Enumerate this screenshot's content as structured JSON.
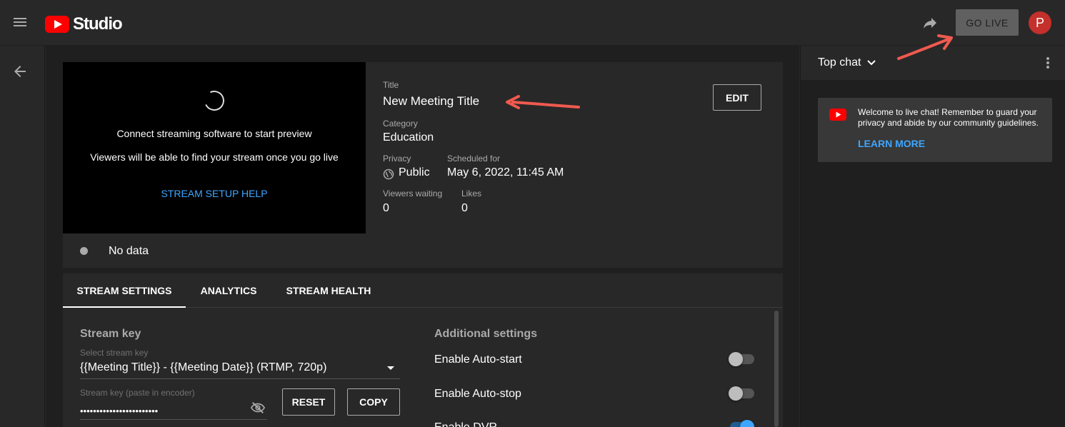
{
  "app": {
    "logo_text": "Studio",
    "go_live_label": "GO LIVE",
    "avatar_initial": "P"
  },
  "preview": {
    "connect_msg": "Connect streaming software to start preview",
    "viewers_msg": "Viewers will be able to find your stream once you go live",
    "setup_help": "STREAM SETUP HELP"
  },
  "stream_info": {
    "title_label": "Title",
    "title_value": "New Meeting Title",
    "category_label": "Category",
    "category_value": "Education",
    "privacy_label": "Privacy",
    "privacy_value": "Public",
    "scheduled_label": "Scheduled for",
    "scheduled_value": "May 6, 2022, 11:45 AM",
    "viewers_label": "Viewers waiting",
    "viewers_value": "0",
    "likes_label": "Likes",
    "likes_value": "0",
    "edit_label": "EDIT"
  },
  "status": {
    "text": "No data"
  },
  "tabs": [
    {
      "label": "STREAM SETTINGS",
      "active": true
    },
    {
      "label": "ANALYTICS",
      "active": false
    },
    {
      "label": "STREAM HEALTH",
      "active": false
    }
  ],
  "stream_key": {
    "section_title": "Stream key",
    "select_label": "Select stream key",
    "select_value": "{{Meeting Title}} - {{Meeting Date}} (RTMP, 720p)",
    "key_label": "Stream key (paste in encoder)",
    "key_value": "••••••••••••••••••••••••",
    "reset_label": "RESET",
    "copy_label": "COPY"
  },
  "additional": {
    "section_title": "Additional settings",
    "settings": [
      {
        "label": "Enable Auto-start",
        "enabled": false
      },
      {
        "label": "Enable Auto-stop",
        "enabled": false
      },
      {
        "label": "Enable DVR",
        "enabled": true
      }
    ]
  },
  "chat": {
    "title": "Top chat",
    "welcome_text": "Welcome to live chat! Remember to guard your privacy and abide by our community guidelines.",
    "learn_more": "LEARN MORE"
  },
  "colors": {
    "accent_blue": "#3ea6ff",
    "youtube_red": "#ff0000",
    "annotation_arrow": "#f05a4f"
  }
}
